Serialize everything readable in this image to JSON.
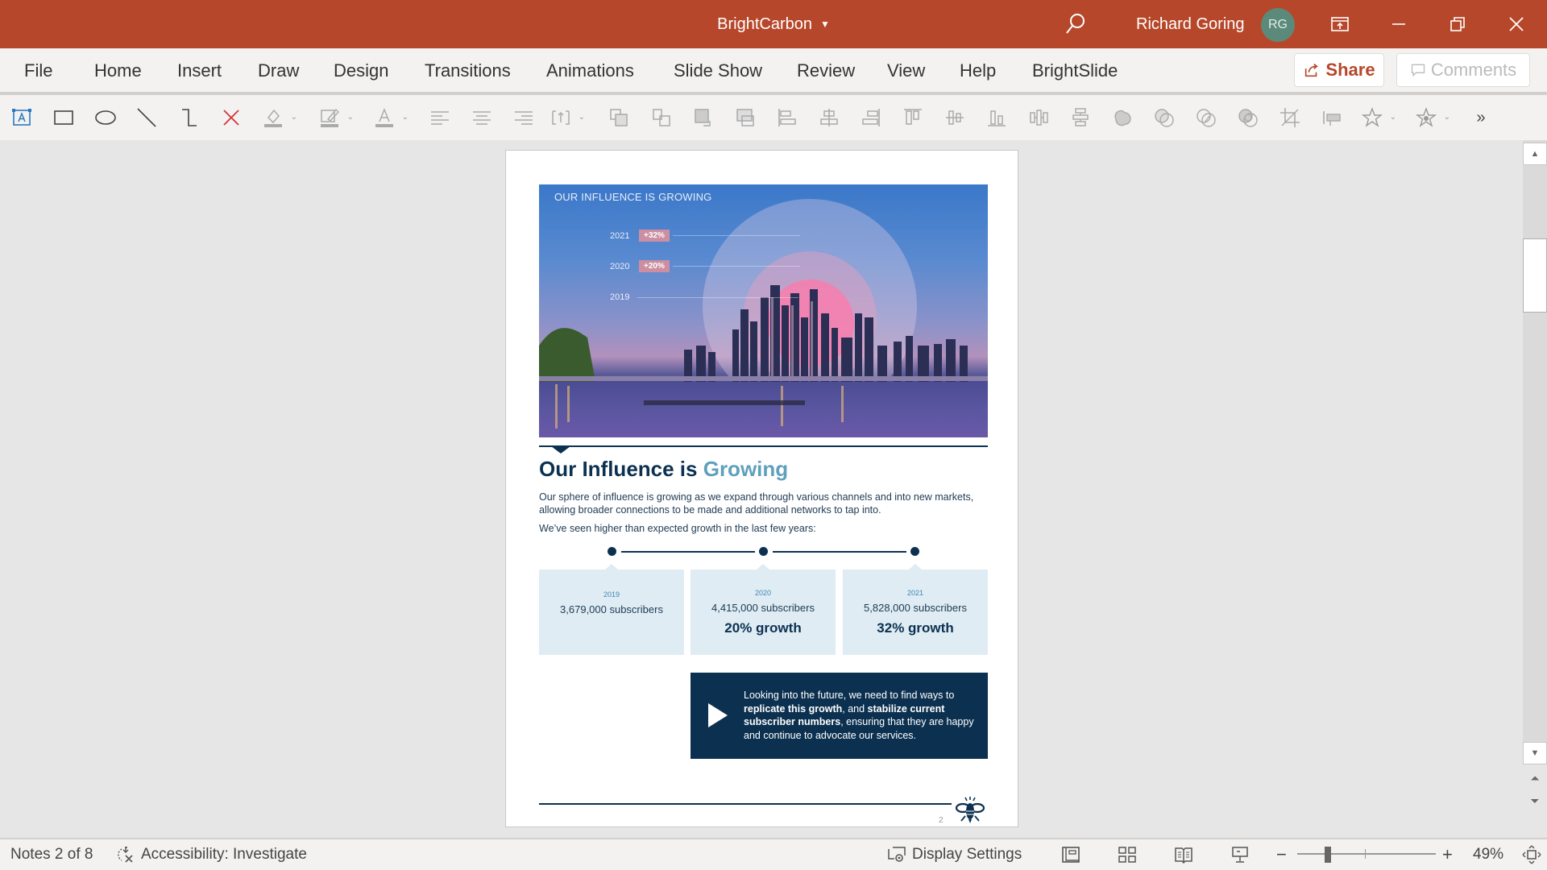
{
  "titlebar": {
    "document_title": "BrightCarbon",
    "user_name": "Richard Goring",
    "user_initials": "RG",
    "search_icon": "search-icon",
    "ribbon_display_icon": "ribbon-display-options-icon",
    "minimize_icon": "minimize-icon",
    "restore_icon": "restore-icon",
    "close_icon": "close-icon"
  },
  "menu": {
    "tabs": [
      "File",
      "Home",
      "Insert",
      "Draw",
      "Design",
      "Transitions",
      "Animations",
      "Slide Show",
      "Review",
      "View",
      "Help",
      "BrightSlide"
    ],
    "share_label": "Share",
    "comments_label": "Comments"
  },
  "toolbar": {
    "tools": [
      "text-box",
      "rectangle",
      "oval",
      "line",
      "elbow-connector",
      "delete",
      "shape-fill",
      "shape-outline",
      "font-color",
      "align-left",
      "align-center",
      "align-right",
      "text-direction",
      "bring-forward",
      "send-backward",
      "bring-to-front",
      "send-to-back",
      "align-objects-left",
      "align-objects-center",
      "align-objects-right",
      "align-objects-top",
      "align-objects-middle",
      "align-objects-bottom",
      "distribute-horizontal",
      "distribute-vertical",
      "merge-union",
      "merge-combine",
      "merge-fragment",
      "merge-intersect",
      "crop",
      "size-position",
      "star-favorite",
      "star-settings",
      "more-tools"
    ]
  },
  "slide": {
    "hero": {
      "title": "OUR INFLUENCE IS GROWING",
      "rows": [
        {
          "year": "2021",
          "change": "+32%"
        },
        {
          "year": "2020",
          "change": "+20%"
        },
        {
          "year": "2019",
          "change": ""
        }
      ]
    },
    "heading_main": "Our Influence is ",
    "heading_accent": "Growing",
    "paragraph": "Our sphere of influence is growing as we expand through various channels and into new markets, allowing broader connections to be made and additional networks to tap into.",
    "paragraph2": "We’ve seen higher than expected growth in the last few years:",
    "stats": [
      {
        "year": "2019",
        "subscribers": "3,679,000 subscribers",
        "growth": ""
      },
      {
        "year": "2020",
        "subscribers": "4,415,000 subscribers",
        "growth": "20% growth"
      },
      {
        "year": "2021",
        "subscribers": "5,828,000 subscribers",
        "growth": "32% growth"
      }
    ],
    "callout": {
      "t1": "Looking into the future, we need to find ways to ",
      "b1": "replicate this growth",
      "t2": ", and ",
      "b2": "stabilize current subscriber numbers",
      "t3": ", ensuring that they are happy and continue to advocate our services."
    },
    "page_number": "2",
    "colors": {
      "navy": "#0c3150",
      "accent": "#5fa0bd",
      "card": "#dfecf4",
      "brand": "#b7472a"
    }
  },
  "statusbar": {
    "notes_position": "Notes 2 of 8",
    "accessibility": "Accessibility: Investigate",
    "display_settings": "Display Settings",
    "zoom_level": "49%",
    "zoom_fraction": 0.49
  }
}
